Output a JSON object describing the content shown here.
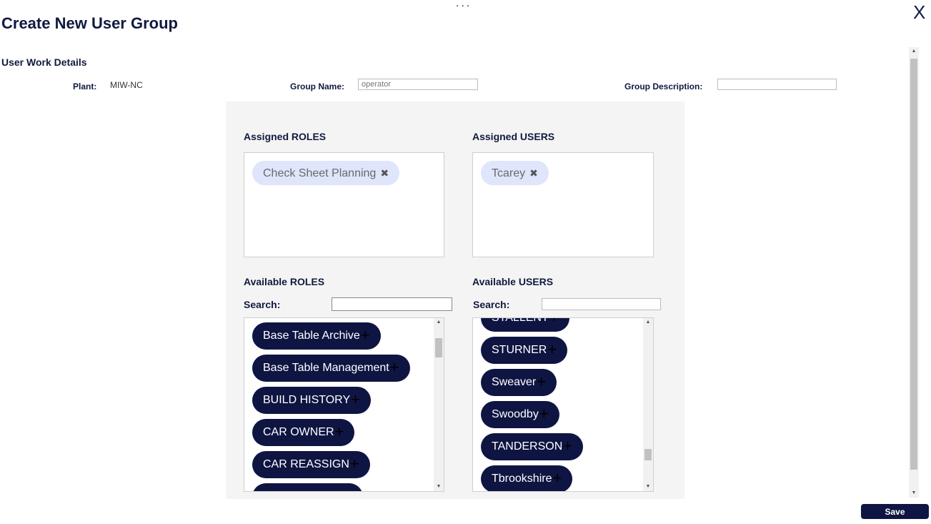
{
  "header": {
    "dots": "...",
    "title": "Create New User Group",
    "close_glyph": "X"
  },
  "details": {
    "section_title": "User Work Details",
    "plant_label": "Plant:",
    "plant_value": "MIW-NC",
    "group_name_label": "Group Name:",
    "group_name_placeholder": "operator",
    "group_name_value": "",
    "group_description_label": "Group Description:",
    "group_description_value": ""
  },
  "roles": {
    "assigned_title": "Assigned ROLES",
    "assigned": [
      {
        "label": "Check Sheet Planning",
        "remove_glyph": "✖"
      }
    ],
    "available_title": "Available ROLES",
    "search_label": "Search:",
    "search_value": "",
    "available": [
      {
        "label": "Base Table Archive",
        "add_glyph": "+"
      },
      {
        "label": "Base Table Management",
        "add_glyph": "+"
      },
      {
        "label": "BUILD HISTORY",
        "add_glyph": "+"
      },
      {
        "label": "CAR OWNER",
        "add_glyph": "+"
      },
      {
        "label": "CAR REASSIGN",
        "add_glyph": "+"
      }
    ]
  },
  "users": {
    "assigned_title": "Assigned USERS",
    "assigned": [
      {
        "label": "Tcarey",
        "remove_glyph": "✖"
      }
    ],
    "available_title": "Available USERS",
    "search_label": "Search:",
    "search_value": "",
    "available": [
      {
        "label": "STALLENT",
        "add_glyph": "+"
      },
      {
        "label": "STURNER",
        "add_glyph": "+"
      },
      {
        "label": "Sweaver",
        "add_glyph": "+"
      },
      {
        "label": "Swoodby",
        "add_glyph": "+"
      },
      {
        "label": "TANDERSON",
        "add_glyph": "+"
      },
      {
        "label": "Tbrookshire",
        "add_glyph": "+"
      }
    ]
  },
  "footer": {
    "save_label": "Save"
  },
  "icons": {
    "close": "close-icon",
    "remove": "remove-x-icon",
    "add": "plus-icon",
    "scroll_up": "arrow-up-icon",
    "scroll_down": "arrow-down-icon"
  },
  "colors": {
    "brand_navy": "#0f1542",
    "chip_light": "#dfe5fa",
    "panel_bg": "#f4f4f4"
  }
}
